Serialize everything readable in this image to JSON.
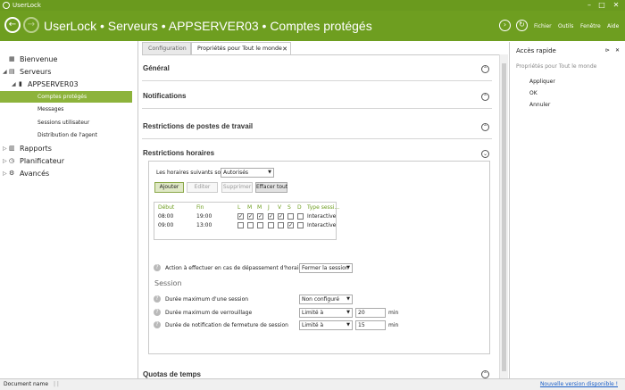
{
  "window": {
    "title": "UserLock",
    "controls": {
      "minimize": "–",
      "maximize": "□",
      "close": "✕"
    }
  },
  "header": {
    "back_glyph": "←",
    "forward_glyph": "→",
    "breadcrumb": "UserLock • Serveurs • APPSERVER03 • Comptes protégés",
    "menus": {
      "fichier": "Fichier",
      "outils": "Outils",
      "fenetre": "Fenêtre",
      "aide": "Aide"
    },
    "accent": "#6e9e20"
  },
  "nav": {
    "bienvenue": "Bienvenue",
    "serveurs": "Serveurs",
    "appserver": "APPSERVER03",
    "comptes": "Comptes protégés",
    "messages": "Messages",
    "sessions": "Sessions utilisateur",
    "distribution": "Distribution de l'agent",
    "rapports": "Rapports",
    "planificateur": "Planificateur",
    "avances": "Avancés",
    "selected_color": "#8db33b"
  },
  "tabs": {
    "configuration": "Configuration",
    "proprietes": "Propriétés pour Tout le monde",
    "close": "✕"
  },
  "sections": {
    "general": "Général",
    "notifications": "Notifications",
    "restrictions_postes": "Restrictions de postes de travail",
    "restrictions_horaires": "Restrictions horaires",
    "quotas": "Quotas de temps"
  },
  "horaires": {
    "label": "Les horaires suivants sont",
    "mode": "Autorisés",
    "buttons": {
      "ajouter": "Ajouter",
      "editer": "Editer",
      "supprimer": "Supprimer",
      "effacer": "Effacer tout"
    },
    "columns": {
      "debut": "Début",
      "fin": "Fin",
      "l": "L",
      "m1": "M",
      "m2": "M",
      "j": "J",
      "v": "V",
      "s": "S",
      "d": "D",
      "type": "Type sessi..."
    },
    "rows": [
      {
        "debut": "08:00",
        "fin": "19:00",
        "type": "Interactive"
      },
      {
        "debut": "09:00",
        "fin": "13:00",
        "type": "Interactive"
      }
    ],
    "check": "✓",
    "action_label": "Action à effectuer en cas de dépassement d'horaire",
    "action_value": "Fermer la session"
  },
  "session": {
    "heading": "Session",
    "duree_max_label": "Durée maximum d'une session",
    "duree_max_value": "Non configuré",
    "verrou_label": "Durée maximum de verrouillage",
    "verrou_mode": "Limité à",
    "verrou_value": "20",
    "notif_label": "Durée de notification de fermeture de session",
    "notif_mode": "Limité à",
    "notif_value": "15",
    "unit": "min"
  },
  "right": {
    "title": "Accès rapide",
    "pin": "⊳",
    "close": "✕",
    "subtitle": "Propriétés pour Tout le monde",
    "actions": {
      "appliquer": "Appliquer",
      "ok": "OK",
      "annuler": "Annuler"
    }
  },
  "status": {
    "doc_name": "Document name",
    "pipes": "| |",
    "new_version": "Nouvelle version disponible !"
  }
}
